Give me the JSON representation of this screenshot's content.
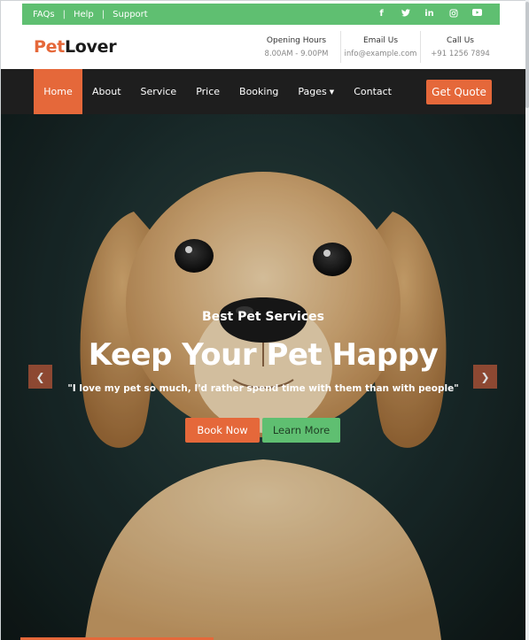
{
  "topbar": {
    "links": [
      "FAQs",
      "Help",
      "Support"
    ],
    "separator": "|",
    "social_icons": [
      "facebook-icon",
      "twitter-icon",
      "linkedin-icon",
      "instagram-icon",
      "youtube-icon"
    ]
  },
  "header": {
    "logo_pet": "Pet",
    "logo_lover": "Lover",
    "info": [
      {
        "title": "Opening Hours",
        "value": "8.00AM - 9.00PM"
      },
      {
        "title": "Email Us",
        "value": "info@example.com"
      },
      {
        "title": "Call Us",
        "value": "+91 1256 7894"
      }
    ]
  },
  "nav": {
    "items": [
      "Home",
      "About",
      "Service",
      "Price",
      "Booking",
      "Pages",
      "Contact"
    ],
    "active": "Home",
    "quote_label": "Get Quote"
  },
  "hero": {
    "eyebrow": "Best Pet Services",
    "headline": "Keep Your Pet Happy",
    "quote": "\"I love my pet so much, I'd rather spend time with them than with people\"",
    "book_label": "Book Now",
    "learn_label": "Learn More",
    "prev_icon": "chevron-left-icon",
    "next_icon": "chevron-right-icon"
  },
  "colors": {
    "green": "#5fbf71",
    "orange": "#e5683a",
    "dark": "#1e1e1e"
  }
}
